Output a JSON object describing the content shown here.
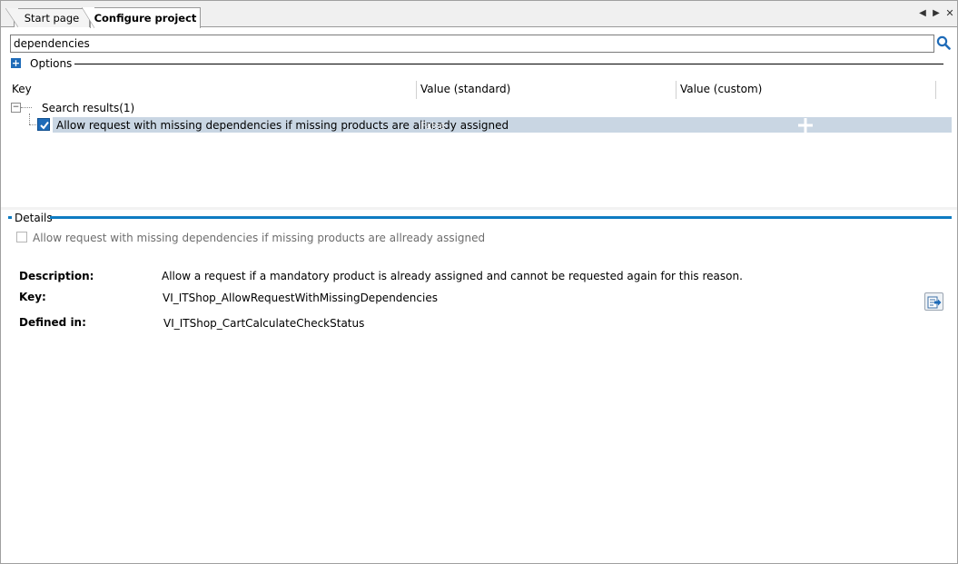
{
  "tabs": [
    {
      "label": "Start page"
    },
    {
      "label": "Configure project"
    }
  ],
  "tab_controls": {
    "prev": "◀",
    "next": "▶",
    "close": "✕"
  },
  "search": {
    "value": "dependencies"
  },
  "options": {
    "label": "Options"
  },
  "grid": {
    "columns": [
      "Key",
      "Value (standard)",
      "Value (custom)"
    ],
    "group_label": "Search results(1)",
    "rows": [
      {
        "checked": true,
        "key": "Allow request with missing dependencies if missing products are allready assigned",
        "standard_value": "False",
        "custom_value": ""
      }
    ]
  },
  "details": {
    "title": "Details",
    "checkbox_label": "Allow request with missing dependencies if missing products are allready assigned",
    "description_label": "Description:",
    "description_value": "Allow a request if a mandatory product is already assigned and cannot be requested again for this reason.",
    "key_label": "Key:",
    "key_value": "VI_ITShop_AllowRequestWithMissingDependencies",
    "defined_label": "Defined in:",
    "defined_value": "VI_ITShop_CartCalculateCheckStatus"
  },
  "colors": {
    "accent": "#0e7bc2",
    "selected_row": "#c9d6e3",
    "checkbox_fill": "#1e6bb8"
  }
}
